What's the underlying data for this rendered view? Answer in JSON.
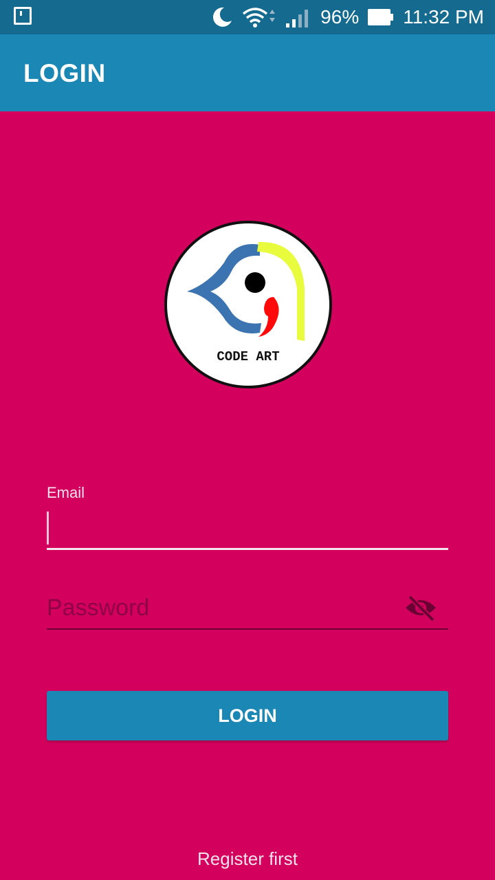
{
  "status_bar": {
    "battery": "96%",
    "time": "11:32 PM",
    "icons": [
      "notification-icon",
      "moon-icon",
      "wifi-icon",
      "cell-signal-icon",
      "battery-icon"
    ]
  },
  "app_bar": {
    "title": "LOGIN"
  },
  "logo": {
    "text": "CODE ART"
  },
  "form": {
    "email_label": "Email",
    "email_value": "",
    "password_placeholder": "Password",
    "password_value": "",
    "login_label": "LOGIN"
  },
  "footer": {
    "register_label": "Register first"
  },
  "colors": {
    "background": "#d3005e",
    "app_bar": "#1a87b4",
    "status_bar": "#156b8f",
    "button": "#1a87b4"
  }
}
